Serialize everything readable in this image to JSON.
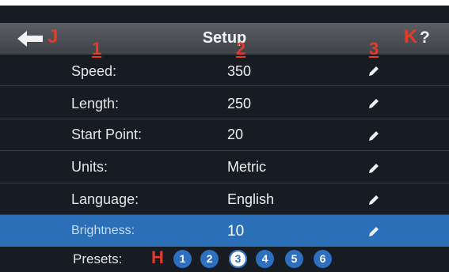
{
  "header": {
    "title": "Setup",
    "help": "?",
    "back_icon": "arrow-left-icon"
  },
  "markers": {
    "back": "J",
    "help": "K",
    "presets": "H",
    "col1": "1",
    "col2": "2",
    "col3": "3"
  },
  "rows": [
    {
      "label": "Speed:",
      "value": "350"
    },
    {
      "label": "Length:",
      "value": "250"
    },
    {
      "label": "Start Point:",
      "value": "20"
    },
    {
      "label": "Units:",
      "value": "Metric"
    },
    {
      "label": "Language:",
      "value": "English"
    },
    {
      "label": "Brightness:",
      "value": "10"
    }
  ],
  "presets": {
    "label": "Presets:",
    "items": [
      "1",
      "2",
      "3",
      "4",
      "5",
      "6"
    ],
    "selected": "3"
  },
  "colors": {
    "accent": "#2a6fb8",
    "marker": "#e23b2a",
    "background": "#171c22"
  }
}
